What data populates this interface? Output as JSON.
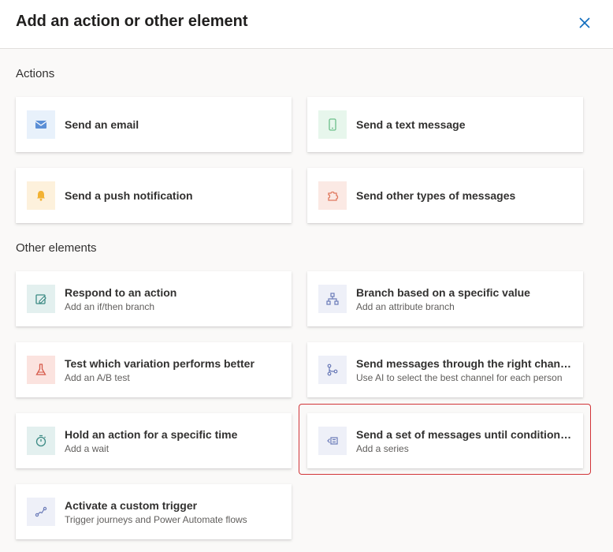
{
  "dialog": {
    "title": "Add an action or other element",
    "close_label": "Close"
  },
  "sections": {
    "actions": "Actions",
    "other": "Other elements"
  },
  "cards": {
    "send_email": {
      "title": "Send an email"
    },
    "send_text": {
      "title": "Send a text message"
    },
    "send_push": {
      "title": "Send a push notification"
    },
    "send_other": {
      "title": "Send other types of messages"
    },
    "respond": {
      "title": "Respond to an action",
      "subtitle": "Add an if/then branch"
    },
    "branch": {
      "title": "Branch based on a specific value",
      "subtitle": "Add an attribute branch"
    },
    "test": {
      "title": "Test which variation performs better",
      "subtitle": "Add an A/B test"
    },
    "channel": {
      "title": "Send messages through the right channel",
      "subtitle": "Use AI to select the best channel for each person"
    },
    "hold": {
      "title": "Hold an action for a specific time",
      "subtitle": "Add a wait"
    },
    "series": {
      "title": "Send a set of messages until conditions are met",
      "subtitle": "Add a series"
    },
    "trigger": {
      "title": "Activate a custom trigger",
      "subtitle": "Trigger journeys and Power Automate flows"
    }
  },
  "icons": {
    "mail": "mail-icon",
    "phone": "phone-icon",
    "bell": "bell-icon",
    "puzzle": "puzzle-icon",
    "respond": "respond-icon",
    "hierarchy": "hierarchy-icon",
    "flask": "flask-icon",
    "channel": "channel-icon",
    "timer": "timer-icon",
    "series": "series-icon",
    "trigger": "trigger-icon"
  },
  "colors": {
    "mail_bg": "#e8f1fb",
    "mail_fg": "#5b8fd6",
    "phone_bg": "#e7f6ec",
    "phone_fg": "#6cbf8a",
    "bell_bg": "#fdf1dc",
    "bell_fg": "#f2b233",
    "puzzle_bg": "#fbe9e4",
    "puzzle_fg": "#e07a5f",
    "teal_bg": "#e3f0ef",
    "teal_fg": "#3d8b85",
    "lavender_bg": "#eef0f8",
    "lavender_fg": "#6b7bb8",
    "flask_bg": "#fbe3df",
    "flask_fg": "#d65a4a",
    "selection_border": "#d13438"
  }
}
